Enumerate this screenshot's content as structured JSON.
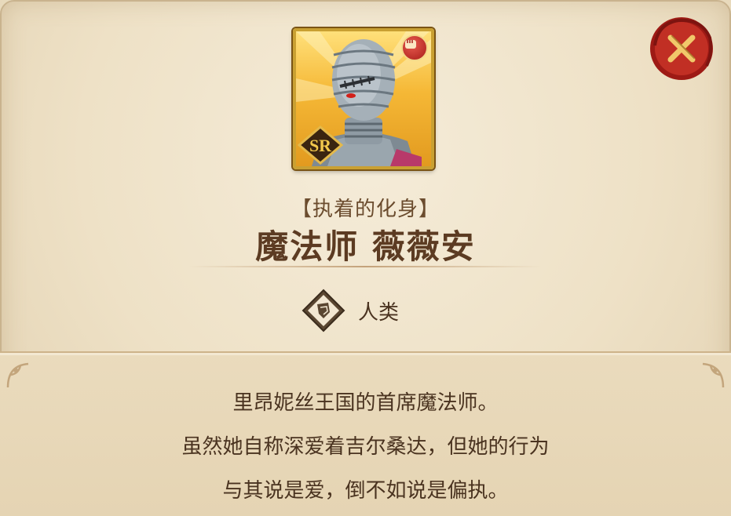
{
  "character": {
    "epithet": "【执着的化身】",
    "name": "魔法师 薇薇安",
    "rarity": "SR",
    "attribute_icon": "fist-icon",
    "race": "人类",
    "race_icon": "human-race-icon"
  },
  "description": {
    "lines": [
      "里昂妮丝王国的首席魔法师。",
      "虽然她自称深爱着吉尔桑达，但她的行为",
      "与其说是爱，倒不如说是偏执。"
    ]
  },
  "colors": {
    "panel_bg": "#eee1c6",
    "frame_gold": "#c9a032",
    "close_red": "#b4231c",
    "text_brown": "#5c3b22"
  },
  "close_icon": "close-x-icon"
}
